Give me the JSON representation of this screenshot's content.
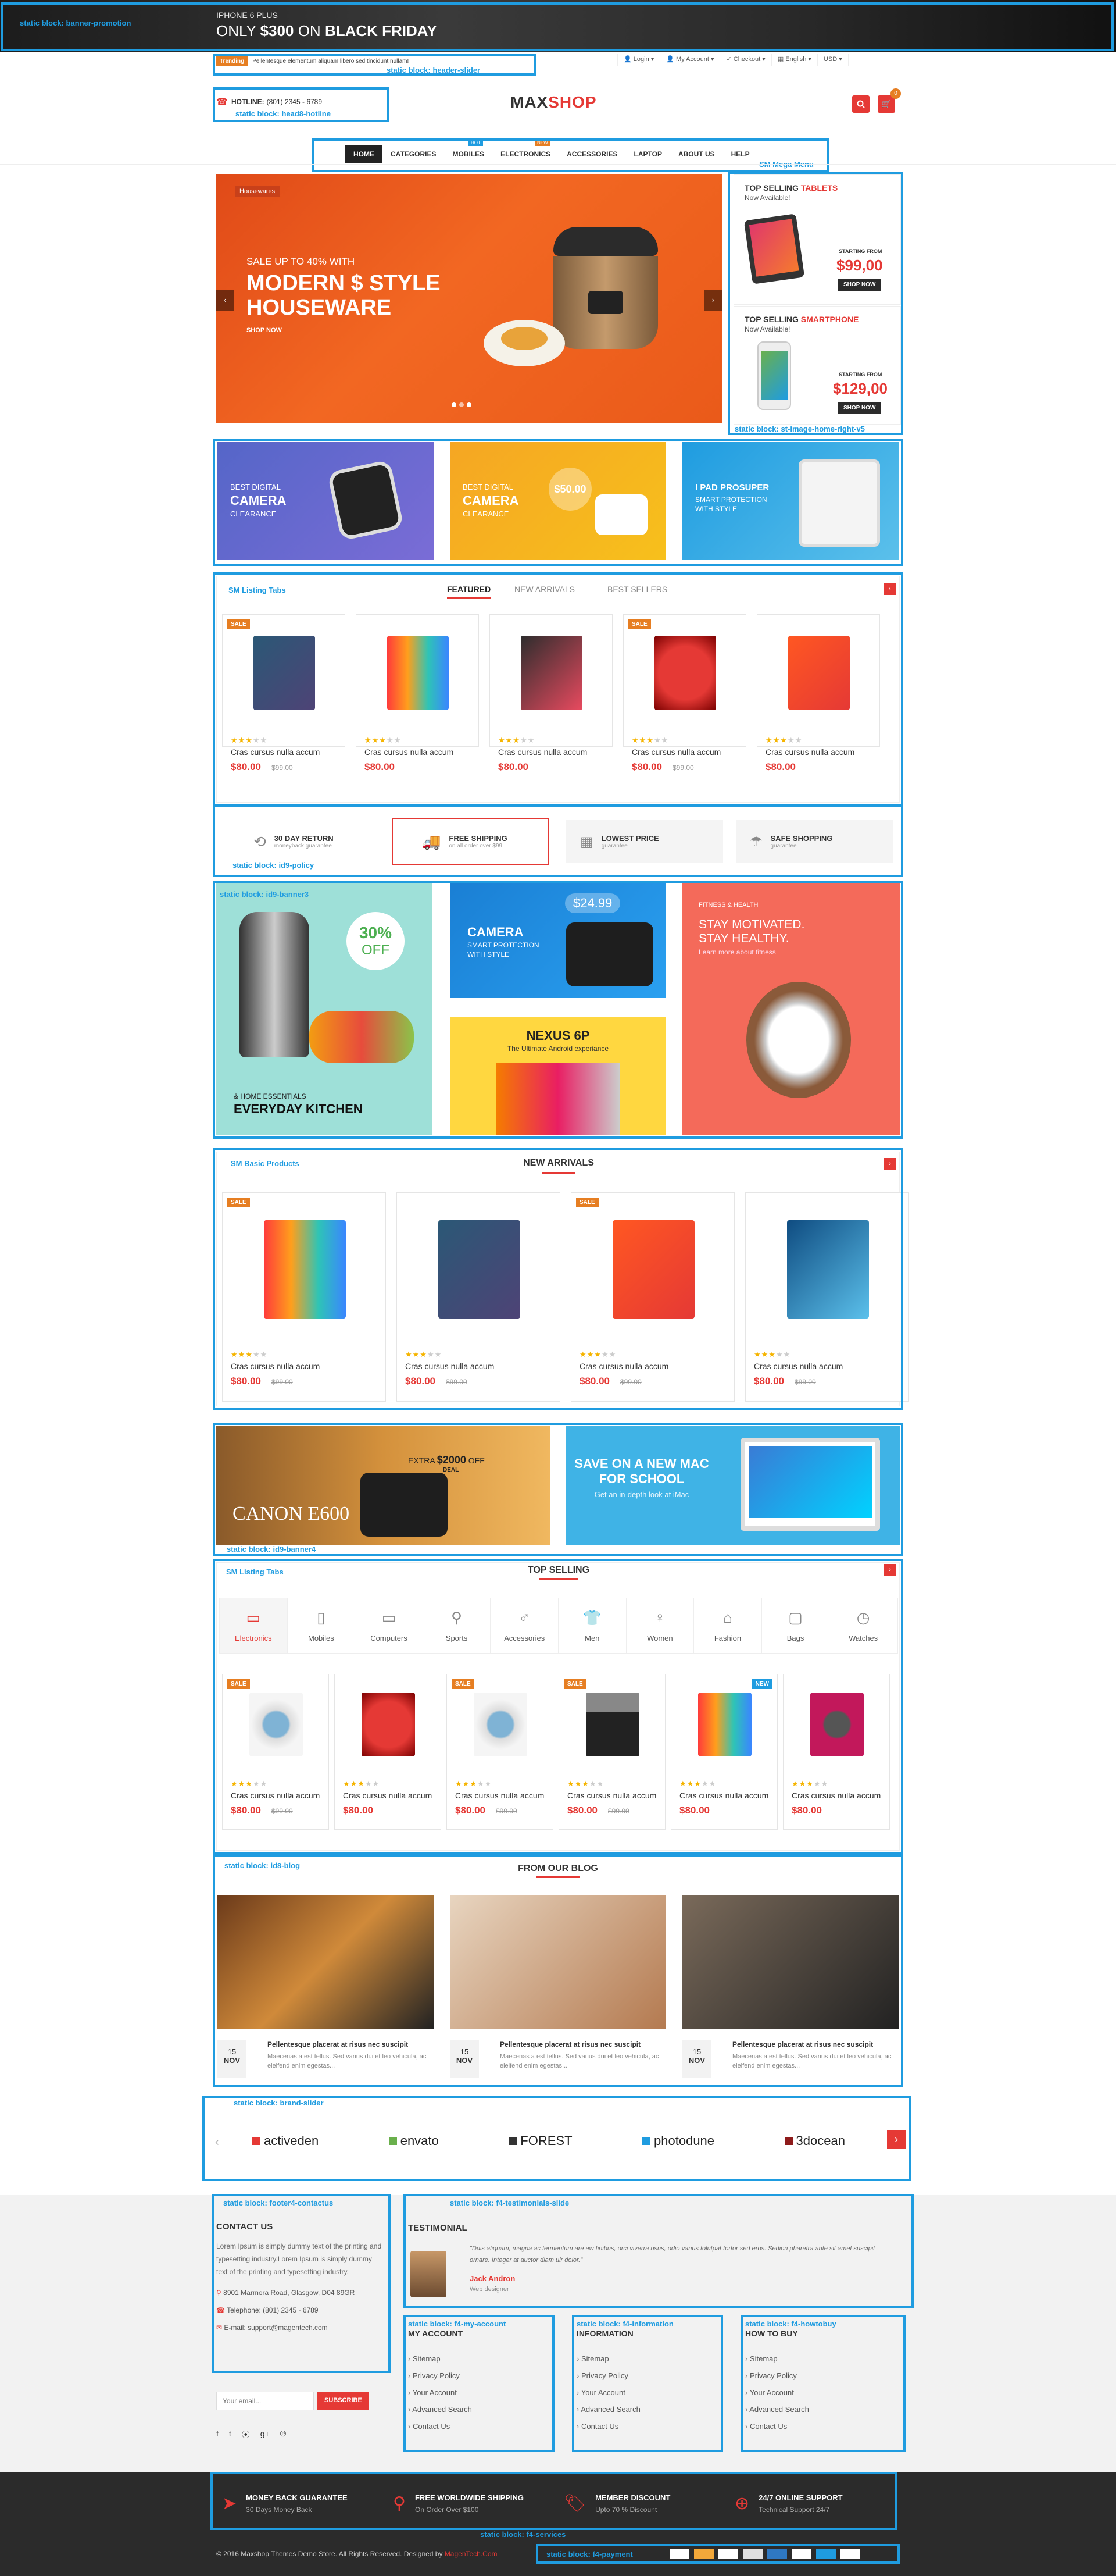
{
  "topbanner": {
    "label": "static block: banner-promotion",
    "model": "IPHONE 6 PLUS",
    "headline_pre": "ONLY ",
    "price": "$300",
    "on": " ON ",
    "event": "BLACK FRIDAY"
  },
  "header": {
    "trending_tag": "Trending",
    "trending_text": "Pellentesque elementum aliquam libero sed tincidunt nullam!",
    "slider_label": "static block: header-slider",
    "links": [
      "Login",
      "My Account",
      "Checkout",
      "English",
      "USD"
    ],
    "hotline_label": "HOTLINE:",
    "hotline_number": "(801) 2345 - 6789",
    "hotline_block": "static block: head8-hotline",
    "logo_a": "MAX",
    "logo_b": "SHOP",
    "cart_count": "0"
  },
  "menu": {
    "label": "SM Mega Menu",
    "items": [
      "HOME",
      "CATEGORIES",
      "MOBILES",
      "ELECTRONICS",
      "ACCESSORIES",
      "LAPTOP",
      "ABOUT US",
      "HELP"
    ],
    "badge_hot": "HOT",
    "badge_new": "NEW"
  },
  "slider": {
    "tag": "Housewares",
    "small": "SALE UP TO 40% WITH",
    "big1": "MODERN $ STYLE",
    "big2": "HOUSEWARE",
    "cta": "SHOP NOW"
  },
  "rightblock": {
    "label": "static block: st-image-home-right-v5",
    "t1a": "TOP SELLING ",
    "t1b": "TABLETS",
    "sub": "Now Available!",
    "starting": "STARTING FROM",
    "p1": "$99,00",
    "shop": "SHOP NOW",
    "t2a": "TOP SELLING ",
    "t2b": "SMARTPHONE",
    "p2": "$129,00"
  },
  "promo3": [
    {
      "l1": "BEST DIGITAL",
      "l2": "CAMERA",
      "l3": "CLEARANCE"
    },
    {
      "l1": "BEST DIGITAL",
      "l2": "CAMERA",
      "l3": "CLEARANCE",
      "price": "$50.00"
    },
    {
      "l1": "I PAD PROSUPER",
      "l2": "SMART PROTECTION",
      "l3": "WITH STYLE"
    }
  ],
  "tabs1": {
    "label": "SM Listing Tabs",
    "tabs": [
      "FEATURED",
      "NEW ARRIVALS",
      "BEST SELLERS"
    ]
  },
  "products": {
    "name": "Cras cursus nulla accum",
    "price": "$80.00",
    "old": "$99.00",
    "sale": "SALE",
    "new": "NEW"
  },
  "policy": {
    "label": "static block: id9-policy",
    "items": [
      {
        "t": "30 DAY RETURN",
        "s": "moneyback guarantee"
      },
      {
        "t": "FREE SHIPPING",
        "s": "on all order over $99"
      },
      {
        "t": "LOWEST PRICE",
        "s": "guarantee"
      },
      {
        "t": "SAFE SHOPPING",
        "s": "guarantee"
      }
    ]
  },
  "banner3": {
    "label": "static block: id9-banner3",
    "pct": "30%",
    "off": "OFF",
    "home": "& HOME ESSENTIALS",
    "kitchen": "EVERYDAY KITCHEN",
    "cam_price": "$24.99",
    "cam": "CAMERA",
    "cam_s1": "SMART PROTECTION",
    "cam_s2": "WITH STYLE",
    "nexus": "NEXUS 6P",
    "nexus_s": "The Ultimate Android experiance",
    "fit": "FITNESS & HEALTH",
    "fit1": "STAY MOTIVATED.",
    "fit2": "STAY HEALTHY.",
    "fit3": "Learn more about fitness"
  },
  "basic": {
    "label": "SM Basic Products",
    "title": "NEW ARRIVALS"
  },
  "banner4": {
    "label": "static block: id9-banner4",
    "extra": "EXTRA ",
    "amt": "$2000",
    "off": " OFF",
    "deal": "DEAL",
    "canon": "CANON E600",
    "mac1": "SAVE ON A NEW MAC",
    "mac2": "FOR SCHOOL",
    "mac3": "Get an in-depth look at iMac"
  },
  "tabs2": {
    "label": "SM Listing Tabs",
    "title": "TOP SELLING",
    "cats": [
      "Electronics",
      "Mobiles",
      "Computers",
      "Sports",
      "Accessories",
      "Men",
      "Women",
      "Fashion",
      "Bags",
      "Watches"
    ]
  },
  "blog": {
    "label": "static block: id8-blog",
    "title": "FROM OUR BLOG",
    "post_title": "Pellentesque placerat at risus nec suscipit",
    "post_text": "Maecenas a est tellus. Sed varius dui et leo vehicula, ac eleifend enim egestas...",
    "day": "15",
    "month": "NOV"
  },
  "brands": {
    "label": "static block: brand-slider",
    "items": [
      "activeden",
      "envato",
      "FOREST",
      "photodune",
      "3docean"
    ]
  },
  "contact": {
    "label": "static block: footer4-contactus",
    "title": "CONTACT US",
    "text": "Lorem Ipsum is simply dummy text of the printing and typesetting industry.Lorem Ipsum is simply dummy text of the printing and typesetting industry.",
    "address": "8901 Marmora Road, Glasgow, D04 89GR",
    "phone": "Telephone: (801) 2345 - 6789",
    "email": "E-mail: support@magentech.com",
    "placeholder": "Your email...",
    "subscribe": "SUBSCRIBE"
  },
  "testimonial": {
    "label": "static block: f4-testimonials-slide",
    "title": "TESTIMONIAL",
    "quote": "\"Duis aliquam, magna ac fermentum are ew finibus, orci viverra risus, odio varius tolutpat tortor sed eros. Sedion pharetra ante sit amet suscipit ornare. Integer at auctor diam ulr dolor.\"",
    "name": "Jack Andron",
    "role": "Web designer"
  },
  "fcols": [
    {
      "label": "static block: f4-my-account",
      "title": "MY ACCOUNT"
    },
    {
      "label": "static block: f4-information",
      "title": "INFORMATION"
    },
    {
      "label": "static block: f4-howtobuy",
      "title": "HOW TO BUY"
    }
  ],
  "flinks": [
    "Sitemap",
    "Privacy Policy",
    "Your Account",
    "Advanced Search",
    "Contact Us"
  ],
  "services": {
    "label": "static block: f4-services",
    "items": [
      {
        "t": "MONEY BACK GUARANTEE",
        "s": "30 Days Money Back"
      },
      {
        "t": "FREE WORLDWIDE SHIPPING",
        "s": "On Order Over $100"
      },
      {
        "t": "MEMBER DISCOUNT",
        "s": "Upto 70 % Discount"
      },
      {
        "t": "24/7 ONLINE SUPPORT",
        "s": "Technical Support 24/7"
      }
    ]
  },
  "copyright": {
    "text": "© 2016 Maxshop Themes Demo Store. All Rights Reserved. Designed by ",
    "by": "MagenTech.Com"
  },
  "payment": {
    "label": "static block: f4-payment"
  },
  "colors": {
    "accent": "#e53935",
    "block": "#1f9ce0",
    "dark": "#2b2b2b"
  }
}
